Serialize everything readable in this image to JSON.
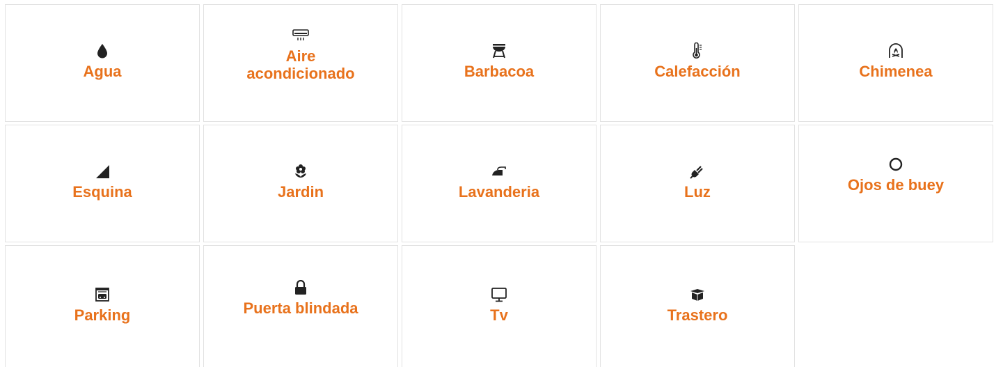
{
  "accent_color": "#e8721c",
  "icon_color": "#222222",
  "features": [
    {
      "label": "Agua",
      "icon": "water-drop-icon"
    },
    {
      "label": "Aire acondicionado",
      "icon": "air-conditioner-icon"
    },
    {
      "label": "Barbacoa",
      "icon": "barbecue-grill-icon"
    },
    {
      "label": "Calefacción",
      "icon": "thermometer-icon"
    },
    {
      "label": "Chimenea",
      "icon": "fireplace-icon"
    },
    {
      "label": "Esquina",
      "icon": "corner-triangle-icon"
    },
    {
      "label": "Jardin",
      "icon": "flower-icon"
    },
    {
      "label": "Lavanderia",
      "icon": "iron-icon"
    },
    {
      "label": "Luz",
      "icon": "plug-icon"
    },
    {
      "label": "Ojos de buey",
      "icon": "circle-ring-icon"
    },
    {
      "label": "Parking",
      "icon": "garage-car-icon"
    },
    {
      "label": "Puerta blindada",
      "icon": "lock-icon"
    },
    {
      "label": "Tv",
      "icon": "monitor-icon"
    },
    {
      "label": "Trastero",
      "icon": "storage-box-icon"
    }
  ]
}
